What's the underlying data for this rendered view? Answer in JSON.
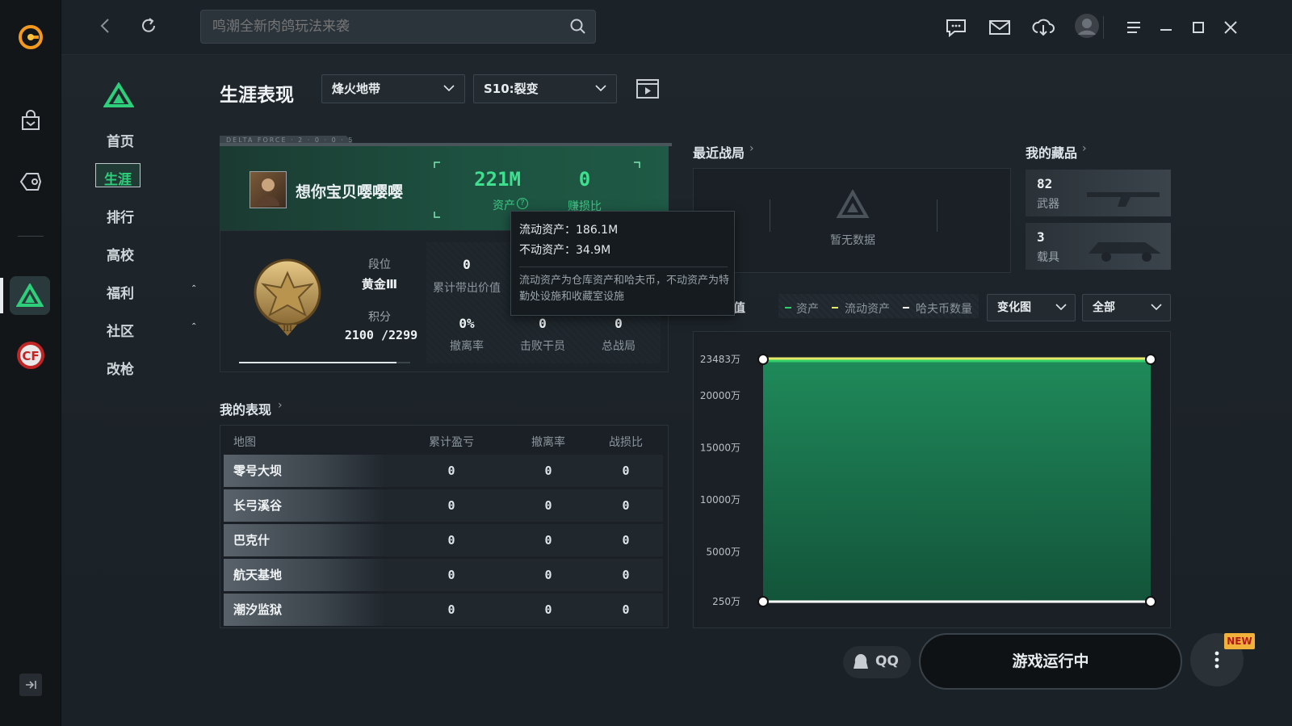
{
  "topbar": {
    "search_placeholder": "鸣潮全新肉鸽玩法来袭"
  },
  "nav": {
    "items": [
      {
        "label": "首页"
      },
      {
        "label": "生涯"
      },
      {
        "label": "排行"
      },
      {
        "label": "高校"
      },
      {
        "label": "福利"
      },
      {
        "label": "社区"
      },
      {
        "label": "改枪"
      }
    ]
  },
  "header": {
    "title": "生涯表现",
    "mode_select": "烽火地带",
    "season_select": "S10:裂变"
  },
  "player_card": {
    "banner_text": "DELTA FORCE · 2 · 0 · 0 · 5",
    "name": "想你宝贝嘤嘤嘤",
    "assets_value": "221M",
    "assets_label": "资产",
    "ratio_value": "0",
    "ratio_label": "赚损比",
    "rank_label": "段位",
    "rank_value": "黄金Ⅲ",
    "score_label": "积分",
    "score_value": "2100 /2299",
    "score_progress_pct": 91.8,
    "stats": [
      {
        "value": "0",
        "label": "累计带出价值"
      },
      {
        "value": "0%",
        "label": "撤离率"
      },
      {
        "value": "0",
        "label": "击败干员"
      },
      {
        "value": "0",
        "label": "总战局"
      }
    ]
  },
  "tooltip": {
    "line1": "流动资产：186.1M",
    "line2": "不动资产：34.9M",
    "desc": "流动资产为仓库资产和哈夫币，不动资产为特勤处设施和收藏室设施"
  },
  "performance": {
    "title": "我的表现",
    "columns": [
      "地图",
      "累计盈亏",
      "撤离率",
      "战损比"
    ],
    "rows": [
      {
        "map": "零号大坝",
        "profit": "0",
        "rate": "0",
        "ratio": "0"
      },
      {
        "map": "长弓溪谷",
        "profit": "0",
        "rate": "0",
        "ratio": "0"
      },
      {
        "map": "巴克什",
        "profit": "0",
        "rate": "0",
        "ratio": "0"
      },
      {
        "map": "航天基地",
        "profit": "0",
        "rate": "0",
        "ratio": "0"
      },
      {
        "map": "潮汐监狱",
        "profit": "0",
        "rate": "0",
        "ratio": "0"
      }
    ]
  },
  "recent": {
    "title": "最近战局",
    "empty": "暂无数据"
  },
  "collection": {
    "title": "我的藏品",
    "items": [
      {
        "count": "82",
        "label": "武器"
      },
      {
        "count": "3",
        "label": "载具"
      }
    ]
  },
  "asset_chart": {
    "title_partial": "值",
    "legend": [
      "资产",
      "流动资产",
      "哈夫币数量"
    ],
    "view_select": "变化图",
    "range_select": "全部"
  },
  "chart_data": {
    "type": "area",
    "title": "",
    "xlabel": "",
    "ylabel": "",
    "y_ticks": [
      "23483万",
      "20000万",
      "15000万",
      "10000万",
      "5000万",
      "250万"
    ],
    "ylim": [
      250,
      23483
    ],
    "series": [
      {
        "name": "资产",
        "color": "#2fd06a",
        "values": [
          23483,
          23483
        ]
      },
      {
        "name": "流动资产",
        "color": "#e6e86a",
        "values": [
          23483,
          23483
        ]
      },
      {
        "name": "哈夫币数量",
        "color": "#ffffff",
        "values": [
          250,
          250
        ]
      }
    ],
    "grid": true
  },
  "bottom": {
    "qq_label": "QQ",
    "launch_label": "游戏运行中",
    "new_badge": "NEW"
  },
  "colors": {
    "accent": "#2ecf7a",
    "bg": "#1c2329"
  }
}
